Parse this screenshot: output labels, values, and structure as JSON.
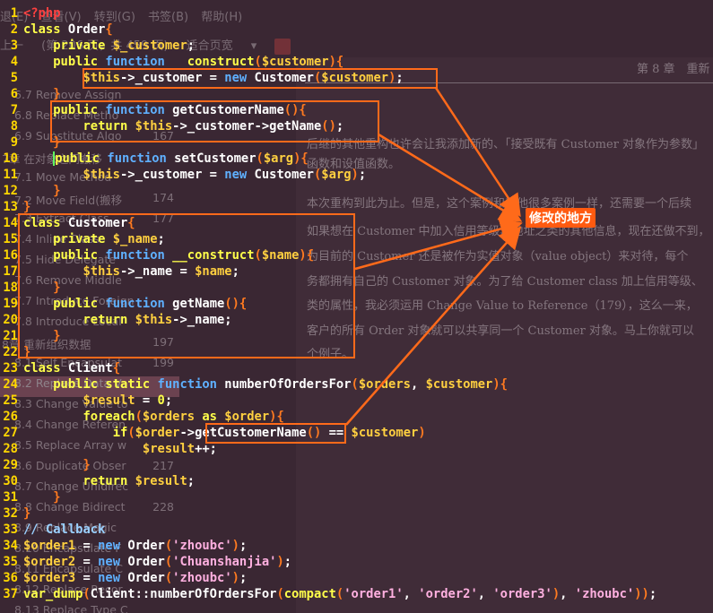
{
  "background": {
    "menu": [
      "退(E)",
      "查看(V)",
      "转到(G)",
      "书签(B)",
      "帮助(H)"
    ],
    "toolbar": {
      "nav": "上一",
      "page_info": "(第 206 页，共 459 页)",
      "zoom": "适合页宽"
    },
    "sidebar": [
      {
        "label": "6.7 Remove Assign",
        "page": ""
      },
      {
        "label": "6.8 Replace Metho",
        "page": ""
      },
      {
        "label": "6.9 Substitute Algo",
        "page": "167"
      },
      {
        "label": "7章 在对象之间搬移",
        "page": ""
      },
      {
        "label": "7.1 Move Method",
        "page": ""
      },
      {
        "label": "7.2 Move Field(搬移",
        "page": "174"
      },
      {
        "label": "7.3 Extract Class",
        "page": "177"
      },
      {
        "label": "7.4 Inline Class",
        "page": ""
      },
      {
        "label": "7.5 Hide Delegate",
        "page": ""
      },
      {
        "label": "7.6 Remove Middle",
        "page": ""
      },
      {
        "label": "7.7 Introduce Foreign",
        "page": ""
      },
      {
        "label": "7.8 Introduce Local",
        "page": ""
      },
      {
        "label": "8章 重新组织数据",
        "page": "197"
      },
      {
        "label": "8.1 Self Encapsulat",
        "page": "199"
      },
      {
        "label": "8.2 Replace Data Va",
        "page": ""
      },
      {
        "label": "8.3 Change Value to",
        "page": ""
      },
      {
        "label": "8.4 Change Referen",
        "page": ""
      },
      {
        "label": "8.5 Replace Array w",
        "page": ""
      },
      {
        "label": "8.6 Duplicate Obser",
        "page": "217"
      },
      {
        "label": "8.7 Change Unidirec",
        "page": ""
      },
      {
        "label": "8.8 Change Bidirect",
        "page": "228"
      },
      {
        "label": "8.9 Replace Magic",
        "page": ""
      },
      {
        "label": "8.10 Encapsulate F",
        "page": ""
      },
      {
        "label": "8.11 Encapsulate C",
        "page": ""
      },
      {
        "label": "8.12 Replace Recor",
        "page": ""
      },
      {
        "label": "8.13 Replace Type C",
        "page": ""
      }
    ],
    "page_header": "第 8 章　重新",
    "paragraphs": [
      "后继的其他重构也许会让我添加新的、「接受既有 Customer 对象作为参数」",
      "函数和设值函数。",
      "本次重构到此为止。但是，这个案例和其他很多案例一样，还需要一个后续",
      "如果想在 Customer 中加入信用等级、地址之类的其他信息，现在还做不到，",
      "为目前的 Customer 还是被作为实值对象（value object）来对待，每个",
      "务都拥有自己的 Customer 对象。为了给 Customer class 加上信用等级、",
      "类的属性，我必须运用 Change Value to Reference（179），这么一来，",
      "客户的所有 Order 对象就可以共享同一个 Customer 对象。马上你就可以",
      "个例子。"
    ]
  },
  "callout": "修改的地方",
  "accent_color": "#ff6a1a",
  "code_lines": [
    {
      "n": "1",
      "segs": [
        [
          "tag",
          "<?php"
        ]
      ]
    },
    {
      "n": "2",
      "segs": [
        [
          "kw",
          "class "
        ],
        [
          "txt",
          "Order"
        ],
        [
          "paren",
          "{"
        ]
      ]
    },
    {
      "n": "3",
      "segs": [
        [
          "txt",
          "    "
        ],
        [
          "kw",
          "private "
        ],
        [
          "var",
          "$_customer"
        ],
        [
          "txt",
          ";"
        ]
      ]
    },
    {
      "n": "4",
      "segs": [
        [
          "txt",
          "    "
        ],
        [
          "kw",
          "public "
        ],
        [
          "kw2",
          "function "
        ],
        [
          "txt",
          "  "
        ],
        [
          "kw",
          "construct"
        ],
        [
          "paren",
          "("
        ],
        [
          "var",
          "$customer"
        ],
        [
          "paren",
          "){"
        ]
      ]
    },
    {
      "n": "5",
      "segs": [
        [
          "txt",
          "        "
        ],
        [
          "var",
          "$this"
        ],
        [
          "txt",
          "->_customer = "
        ],
        [
          "kw2",
          "new "
        ],
        [
          "txt",
          "Customer"
        ],
        [
          "paren",
          "("
        ],
        [
          "var",
          "$customer"
        ],
        [
          "paren",
          ")"
        ],
        [
          "txt",
          ";"
        ]
      ]
    },
    {
      "n": "6",
      "segs": [
        [
          "txt",
          "    "
        ],
        [
          "paren",
          "}"
        ]
      ]
    },
    {
      "n": "7",
      "segs": [
        [
          "txt",
          "    "
        ],
        [
          "kw",
          "public "
        ],
        [
          "kw2",
          "function "
        ],
        [
          "txt",
          "getCustomerName"
        ],
        [
          "paren",
          "(){"
        ]
      ]
    },
    {
      "n": "8",
      "segs": [
        [
          "txt",
          "        "
        ],
        [
          "kw",
          "return "
        ],
        [
          "var",
          "$this"
        ],
        [
          "txt",
          "->_customer->getName"
        ],
        [
          "paren",
          "()"
        ],
        [
          "txt",
          ";"
        ]
      ]
    },
    {
      "n": "9",
      "segs": [
        [
          "txt",
          "    "
        ],
        [
          "paren",
          "}"
        ]
      ]
    },
    {
      "n": "10",
      "segs": [
        [
          "txt",
          "    "
        ],
        [
          "cursor",
          ""
        ],
        [
          "kw",
          "public "
        ],
        [
          "kw2",
          "function "
        ],
        [
          "txt",
          "setCustomer"
        ],
        [
          "paren",
          "("
        ],
        [
          "var",
          "$arg"
        ],
        [
          "paren",
          "){"
        ]
      ]
    },
    {
      "n": "11",
      "segs": [
        [
          "txt",
          "        "
        ],
        [
          "var",
          "$this"
        ],
        [
          "txt",
          "->_customer = "
        ],
        [
          "kw2",
          "new "
        ],
        [
          "txt",
          "Customer"
        ],
        [
          "paren",
          "("
        ],
        [
          "var",
          "$arg"
        ],
        [
          "paren",
          ")"
        ],
        [
          "txt",
          ";"
        ]
      ]
    },
    {
      "n": "12",
      "segs": [
        [
          "txt",
          "    "
        ],
        [
          "paren",
          "}"
        ]
      ]
    },
    {
      "n": "13",
      "segs": [
        [
          "paren",
          "}"
        ]
      ]
    },
    {
      "n": "14",
      "segs": [
        [
          "kw",
          "class "
        ],
        [
          "txt",
          "Customer"
        ],
        [
          "paren",
          "{"
        ]
      ]
    },
    {
      "n": "15",
      "segs": [
        [
          "txt",
          "    "
        ],
        [
          "kw",
          "private "
        ],
        [
          "var",
          "$_name"
        ],
        [
          "txt",
          ";"
        ]
      ]
    },
    {
      "n": "16",
      "segs": [
        [
          "txt",
          "    "
        ],
        [
          "kw",
          "public "
        ],
        [
          "kw2",
          "function "
        ],
        [
          "kw",
          "__construct"
        ],
        [
          "paren",
          "("
        ],
        [
          "var",
          "$name"
        ],
        [
          "paren",
          "){"
        ]
      ]
    },
    {
      "n": "17",
      "segs": [
        [
          "txt",
          "        "
        ],
        [
          "var",
          "$this"
        ],
        [
          "txt",
          "->_name = "
        ],
        [
          "var",
          "$name"
        ],
        [
          "txt",
          ";"
        ]
      ]
    },
    {
      "n": "18",
      "segs": [
        [
          "txt",
          "    "
        ],
        [
          "paren",
          "}"
        ]
      ]
    },
    {
      "n": "19",
      "segs": [
        [
          "txt",
          "    "
        ],
        [
          "kw",
          "public "
        ],
        [
          "kw2",
          "function "
        ],
        [
          "txt",
          "getName"
        ],
        [
          "paren",
          "(){"
        ]
      ]
    },
    {
      "n": "20",
      "segs": [
        [
          "txt",
          "        "
        ],
        [
          "kw",
          "return "
        ],
        [
          "var",
          "$this"
        ],
        [
          "txt",
          "->_name;"
        ]
      ]
    },
    {
      "n": "21",
      "segs": [
        [
          "txt",
          "    "
        ],
        [
          "paren",
          "}"
        ]
      ]
    },
    {
      "n": "22",
      "segs": [
        [
          "paren",
          "}"
        ]
      ]
    },
    {
      "n": "23",
      "segs": [
        [
          "kw",
          "class "
        ],
        [
          "txt",
          "Client"
        ],
        [
          "paren",
          "{"
        ]
      ]
    },
    {
      "n": "24",
      "segs": [
        [
          "txt",
          "    "
        ],
        [
          "kw",
          "public static "
        ],
        [
          "kw2",
          "function "
        ],
        [
          "txt",
          "numberOfOrdersFor"
        ],
        [
          "paren",
          "("
        ],
        [
          "var",
          "$orders"
        ],
        [
          "txt",
          ", "
        ],
        [
          "var",
          "$customer"
        ],
        [
          "paren",
          "){"
        ]
      ]
    },
    {
      "n": "25",
      "segs": [
        [
          "txt",
          "        "
        ],
        [
          "var",
          "$result"
        ],
        [
          "txt",
          " = "
        ],
        [
          "kw",
          "0"
        ],
        [
          "txt",
          ";"
        ]
      ]
    },
    {
      "n": "26",
      "segs": [
        [
          "txt",
          "        "
        ],
        [
          "kw",
          "foreach"
        ],
        [
          "paren",
          "("
        ],
        [
          "var",
          "$orders "
        ],
        [
          "kw",
          "as "
        ],
        [
          "var",
          "$order"
        ],
        [
          "paren",
          "){"
        ]
      ]
    },
    {
      "n": "27",
      "segs": [
        [
          "txt",
          "            "
        ],
        [
          "kw",
          "if"
        ],
        [
          "paren",
          "("
        ],
        [
          "var",
          "$order"
        ],
        [
          "txt",
          "->getCustomerName"
        ],
        [
          "paren",
          "()"
        ],
        [
          "txt",
          " == "
        ],
        [
          "var",
          "$customer"
        ],
        [
          "paren",
          ")"
        ]
      ]
    },
    {
      "n": "28",
      "segs": [
        [
          "txt",
          "                "
        ],
        [
          "var",
          "$result"
        ],
        [
          "txt",
          "++;"
        ]
      ]
    },
    {
      "n": "29",
      "segs": [
        [
          "txt",
          "        "
        ],
        [
          "paren",
          "}"
        ]
      ]
    },
    {
      "n": "30",
      "segs": [
        [
          "txt",
          "        "
        ],
        [
          "kw",
          "return "
        ],
        [
          "var",
          "$result"
        ],
        [
          "txt",
          ";"
        ]
      ]
    },
    {
      "n": "31",
      "segs": [
        [
          "txt",
          "    "
        ],
        [
          "paren",
          "}"
        ]
      ]
    },
    {
      "n": "32",
      "segs": [
        [
          "paren",
          "}"
        ]
      ]
    },
    {
      "n": "33",
      "segs": [
        [
          "cmt",
          "// Callback"
        ]
      ]
    },
    {
      "n": "34",
      "segs": [
        [
          "var",
          "$order1"
        ],
        [
          "txt",
          " = "
        ],
        [
          "kw2",
          "new "
        ],
        [
          "txt",
          "Order"
        ],
        [
          "paren",
          "("
        ],
        [
          "str",
          "'zhoubc'"
        ],
        [
          "paren",
          ")"
        ],
        [
          "txt",
          ";"
        ]
      ]
    },
    {
      "n": "35",
      "segs": [
        [
          "var",
          "$order2"
        ],
        [
          "txt",
          " = "
        ],
        [
          "kw2",
          "new "
        ],
        [
          "txt",
          "Order"
        ],
        [
          "paren",
          "("
        ],
        [
          "str",
          "'Chuanshanjia'"
        ],
        [
          "paren",
          ")"
        ],
        [
          "txt",
          ";"
        ]
      ]
    },
    {
      "n": "36",
      "segs": [
        [
          "var",
          "$order3"
        ],
        [
          "txt",
          " = "
        ],
        [
          "kw2",
          "new "
        ],
        [
          "txt",
          "Order"
        ],
        [
          "paren",
          "("
        ],
        [
          "str",
          "'zhoubc'"
        ],
        [
          "paren",
          ")"
        ],
        [
          "txt",
          ";"
        ]
      ]
    },
    {
      "n": "37",
      "segs": [
        [
          "kw",
          "var_dump"
        ],
        [
          "paren",
          "("
        ],
        [
          "txt",
          "Client::numberOfOrdersFor"
        ],
        [
          "paren",
          "("
        ],
        [
          "kw",
          "compact"
        ],
        [
          "paren",
          "("
        ],
        [
          "str",
          "'order1'"
        ],
        [
          "txt",
          ", "
        ],
        [
          "str",
          "'order2'"
        ],
        [
          "txt",
          ", "
        ],
        [
          "str",
          "'order3'"
        ],
        [
          "paren",
          ")"
        ],
        [
          "txt",
          ", "
        ],
        [
          "str",
          "'zhoubc'"
        ],
        [
          "paren",
          "))"
        ],
        [
          "txt",
          ";"
        ]
      ]
    }
  ]
}
